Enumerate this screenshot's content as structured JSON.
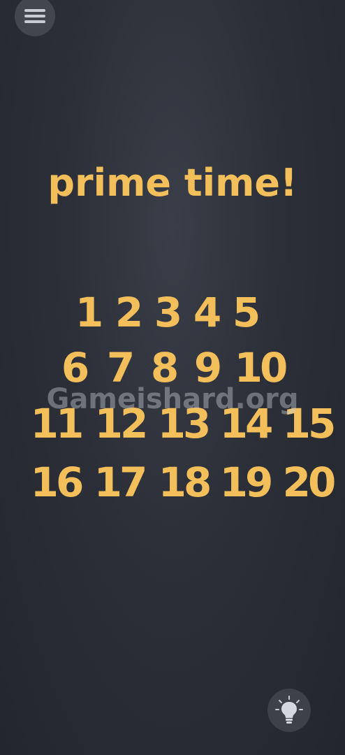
{
  "title": "prime time!",
  "numbers": [
    "1",
    "2",
    "3",
    "4",
    "5",
    "6",
    "7",
    "8",
    "9",
    "10",
    "11",
    "12",
    "13",
    "14",
    "15",
    "16",
    "17",
    "18",
    "19",
    "20"
  ],
  "watermark": "Gameishard.org",
  "icons": {
    "menu": "hamburger-menu-icon",
    "hint": "lightbulb-icon"
  },
  "colors": {
    "accent": "#f2bf5a",
    "background": "#2c2f37",
    "button": "#42464f"
  }
}
